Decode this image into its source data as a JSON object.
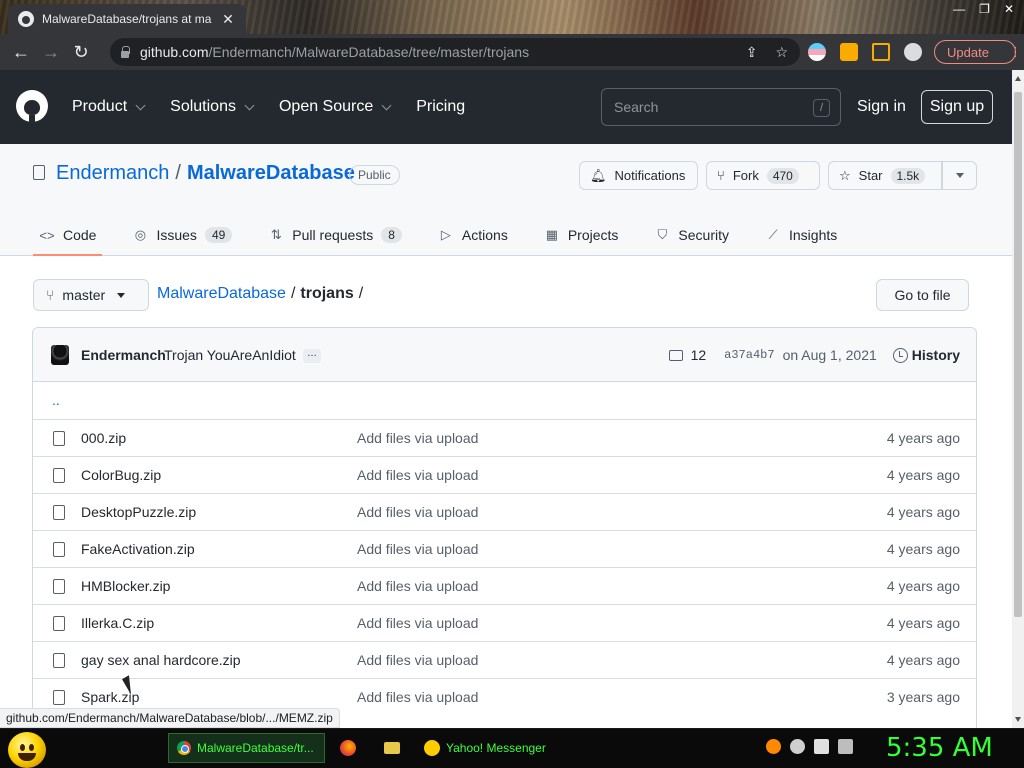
{
  "browser": {
    "tab_title": "MalwareDatabase/trojans at ma",
    "url_host": "github.com",
    "url_path": "/Endermanch/MalwareDatabase/tree/master/trojans",
    "update_label": "Update",
    "status_url": "github.com/Endermanch/MalwareDatabase/blob/.../MEMZ.zip"
  },
  "gh_header": {
    "nav": [
      "Product",
      "Solutions",
      "Open Source",
      "Pricing"
    ],
    "search_placeholder": "Search",
    "search_shortcut": "/",
    "sign_in": "Sign in",
    "sign_up": "Sign up"
  },
  "repo": {
    "owner": "Endermanch",
    "separator": "/",
    "name": "MalwareDatabase",
    "visibility": "Public",
    "notifications_label": "Notifications",
    "fork_label": "Fork",
    "fork_count": "470",
    "star_label": "Star",
    "star_count": "1.5k",
    "tabs": [
      {
        "label": "Code",
        "icon": "code-icon"
      },
      {
        "label": "Issues",
        "count": "49",
        "icon": "issue-icon"
      },
      {
        "label": "Pull requests",
        "count": "8",
        "icon": "pull-request-icon"
      },
      {
        "label": "Actions",
        "icon": "play-icon"
      },
      {
        "label": "Projects",
        "icon": "table-icon"
      },
      {
        "label": "Security",
        "icon": "shield-icon"
      },
      {
        "label": "Insights",
        "icon": "graph-icon"
      }
    ]
  },
  "browse": {
    "branch": "master",
    "crumb_repo": "MalwareDatabase",
    "crumb_sep1": "/",
    "crumb_dir": "trojans",
    "crumb_sep2": "/",
    "go_to_file": "Go to file"
  },
  "commit": {
    "author": "Endermanch",
    "message": "Trojan YouAreAnIdiot",
    "ellipsis": "…",
    "comments": "12",
    "sha": "a37a4b7",
    "date": "on Aug 1, 2021",
    "history_label": "History"
  },
  "files": {
    "parent": "..",
    "rows": [
      {
        "name": "000.zip",
        "message": "Add files via upload",
        "age": "4 years ago"
      },
      {
        "name": "ColorBug.zip",
        "message": "Add files via upload",
        "age": "4 years ago"
      },
      {
        "name": "DesktopPuzzle.zip",
        "message": "Add files via upload",
        "age": "4 years ago"
      },
      {
        "name": "FakeActivation.zip",
        "message": "Add files via upload",
        "age": "4 years ago"
      },
      {
        "name": "HMBlocker.zip",
        "message": "Add files via upload",
        "age": "4 years ago"
      },
      {
        "name": "Illerka.C.zip",
        "message": "Add files via upload",
        "age": "4 years ago"
      },
      {
        "name": "gay sex anal hardcore.zip",
        "message": "Add files via upload",
        "age": "4 years ago"
      },
      {
        "name": "Spark.zip",
        "message": "Add files via upload",
        "age": "3 years ago"
      }
    ]
  },
  "taskbar": {
    "items": [
      {
        "label": "MalwareDatabase/tr...",
        "icon": "chrome-icon"
      },
      {
        "label": "",
        "icon": "firefox-icon"
      },
      {
        "label": "",
        "icon": "folder-icon"
      },
      {
        "label": "Yahoo! Messenger",
        "icon": "yahoo-messenger-icon"
      }
    ],
    "clock": "5:35 AM"
  },
  "colors": {
    "accent": "#0969da",
    "header_bg": "#24292f",
    "tab_underline": "#fd8c73",
    "taskbar_text": "#33ff33"
  }
}
